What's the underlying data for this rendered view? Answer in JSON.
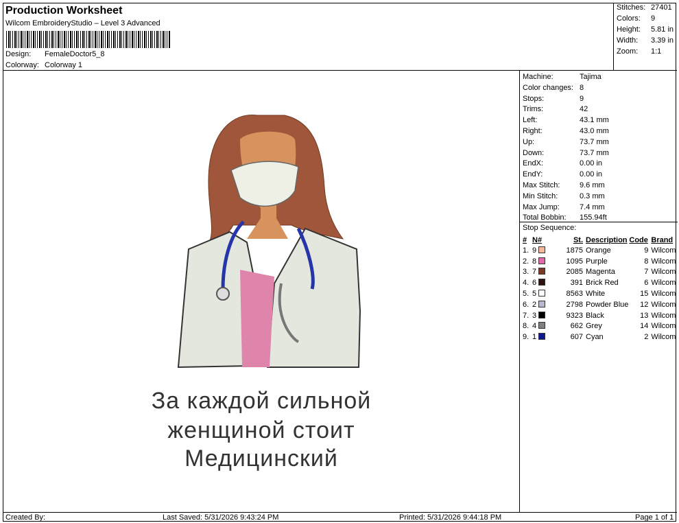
{
  "header": {
    "title": "Production Worksheet",
    "software": "Wilcom EmbroideryStudio – Level 3 Advanced",
    "design_label": "Design:",
    "design_value": "FemaleDoctor5_8",
    "colorway_label": "Colorway:",
    "colorway_value": "Colorway 1"
  },
  "stats": {
    "stitches_label": "Stitches:",
    "stitches": "27401",
    "colors_label": "Colors:",
    "colors": "9",
    "height_label": "Height:",
    "height": "5.81 in",
    "width_label": "Width:",
    "width": "3.39 in",
    "zoom_label": "Zoom:",
    "zoom": "1:1"
  },
  "machine_info": [
    {
      "label": "Machine:",
      "value": "Tajima"
    },
    {
      "label": "Color changes:",
      "value": "8"
    },
    {
      "label": "Stops:",
      "value": "9"
    },
    {
      "label": "Trims:",
      "value": "42"
    },
    {
      "label": "Left:",
      "value": "43.1 mm"
    },
    {
      "label": "Right:",
      "value": "43.0 mm"
    },
    {
      "label": "Up:",
      "value": "73.7 mm"
    },
    {
      "label": "Down:",
      "value": "73.7 mm"
    },
    {
      "label": "EndX:",
      "value": "0.00 in"
    },
    {
      "label": "EndY:",
      "value": "0.00 in"
    },
    {
      "label": "Max Stitch:",
      "value": "9.6 mm"
    },
    {
      "label": "Min Stitch:",
      "value": "0.3 mm"
    },
    {
      "label": "Max Jump:",
      "value": "7.4 mm"
    },
    {
      "label": "Total Bobbin:",
      "value": "155.94ft"
    }
  ],
  "stop_sequence": {
    "title": "Stop Sequence:",
    "columns": [
      "#",
      "N#",
      "St.",
      "Description",
      "Code",
      "Brand"
    ],
    "rows": [
      {
        "num": "1.",
        "n": "9",
        "color": "#f4b99a",
        "st": "1875",
        "desc": "Orange",
        "code": "9",
        "brand": "Wilcom"
      },
      {
        "num": "2.",
        "n": "8",
        "color": "#e06aa8",
        "st": "1095",
        "desc": "Purple",
        "code": "8",
        "brand": "Wilcom"
      },
      {
        "num": "3.",
        "n": "7",
        "color": "#7a3b22",
        "st": "2085",
        "desc": "Magenta",
        "code": "7",
        "brand": "Wilcom"
      },
      {
        "num": "4.",
        "n": "6",
        "color": "#2b1410",
        "st": "391",
        "desc": "Brick Red",
        "code": "6",
        "brand": "Wilcom"
      },
      {
        "num": "5.",
        "n": "5",
        "color": "#ffffff",
        "st": "8563",
        "desc": "White",
        "code": "15",
        "brand": "Wilcom"
      },
      {
        "num": "6.",
        "n": "2",
        "color": "#b8b8cc",
        "st": "2798",
        "desc": "Powder Blue",
        "code": "12",
        "brand": "Wilcom"
      },
      {
        "num": "7.",
        "n": "3",
        "color": "#000000",
        "st": "9323",
        "desc": "Black",
        "code": "13",
        "brand": "Wilcom"
      },
      {
        "num": "8.",
        "n": "4",
        "color": "#7f7f7f",
        "st": "662",
        "desc": "Grey",
        "code": "14",
        "brand": "Wilcom"
      },
      {
        "num": "9.",
        "n": "1",
        "color": "#101890",
        "st": "607",
        "desc": "Cyan",
        "code": "2",
        "brand": "Wilcom"
      }
    ]
  },
  "design_text": {
    "line1": "За каждой сильной",
    "line2": "женщиной стоит",
    "line3": "Медицинский"
  },
  "footer": {
    "created": "Created By:",
    "saved": "Last Saved: 5/31/2026 9:43:24 PM",
    "printed": "Printed: 5/31/2026 9:44:18 PM",
    "page": "Page 1 of 1"
  }
}
